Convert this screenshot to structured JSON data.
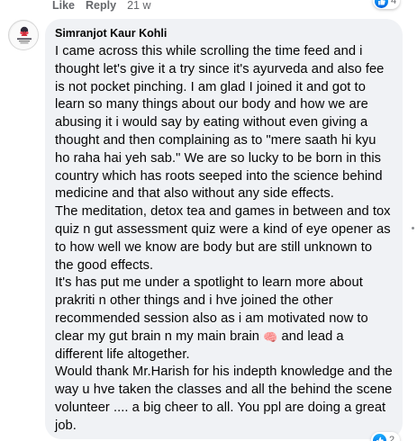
{
  "previous_comment": {
    "like_label": "Like",
    "reply_label": "Reply",
    "timestamp": "21 w",
    "reaction_count": "4",
    "reaction_color": "#1877f2"
  },
  "comment": {
    "author": "Simranjot Kaur Kohli",
    "avatar_icon": "brand-logo-avatar",
    "paragraphs": [
      "I came across this while scrolling the time feed and i thought let's give it a try since it's ayurveda and also fee is not pocket pinching. I am glad I joined it and got to learn so many things about our body and how we are abusing it i would say by eating without even giving a thought and then complaining as to \"mere saath hi kyu ho raha hai yeh sab.\" We are so lucky to be born in this country which has roots seeped into the science behind medicine and that also without any side effects.",
      "The meditation, detox tea and games in between and tox quiz n gut assessment quiz were a kind of eye opener as to how well we know are body but are still unknown to the good effects.",
      "It's has put me under a spotlight to learn more about prakriti n other things and i hve joined the other recommended session also as i am motivated now to clear my gut brain n my main brain",
      "and lead a different life altogether.",
      "Would thank Mr.Harish for his indepth knowledge and the way u hve taken the classes and all the behind the scene volunteer .... a big cheer to all. You ppl are doing a great job."
    ],
    "emoji": "🧠",
    "emoji_name": "brain-emoji",
    "reaction_count": "2",
    "bubble_color": "#f0f2f5"
  }
}
